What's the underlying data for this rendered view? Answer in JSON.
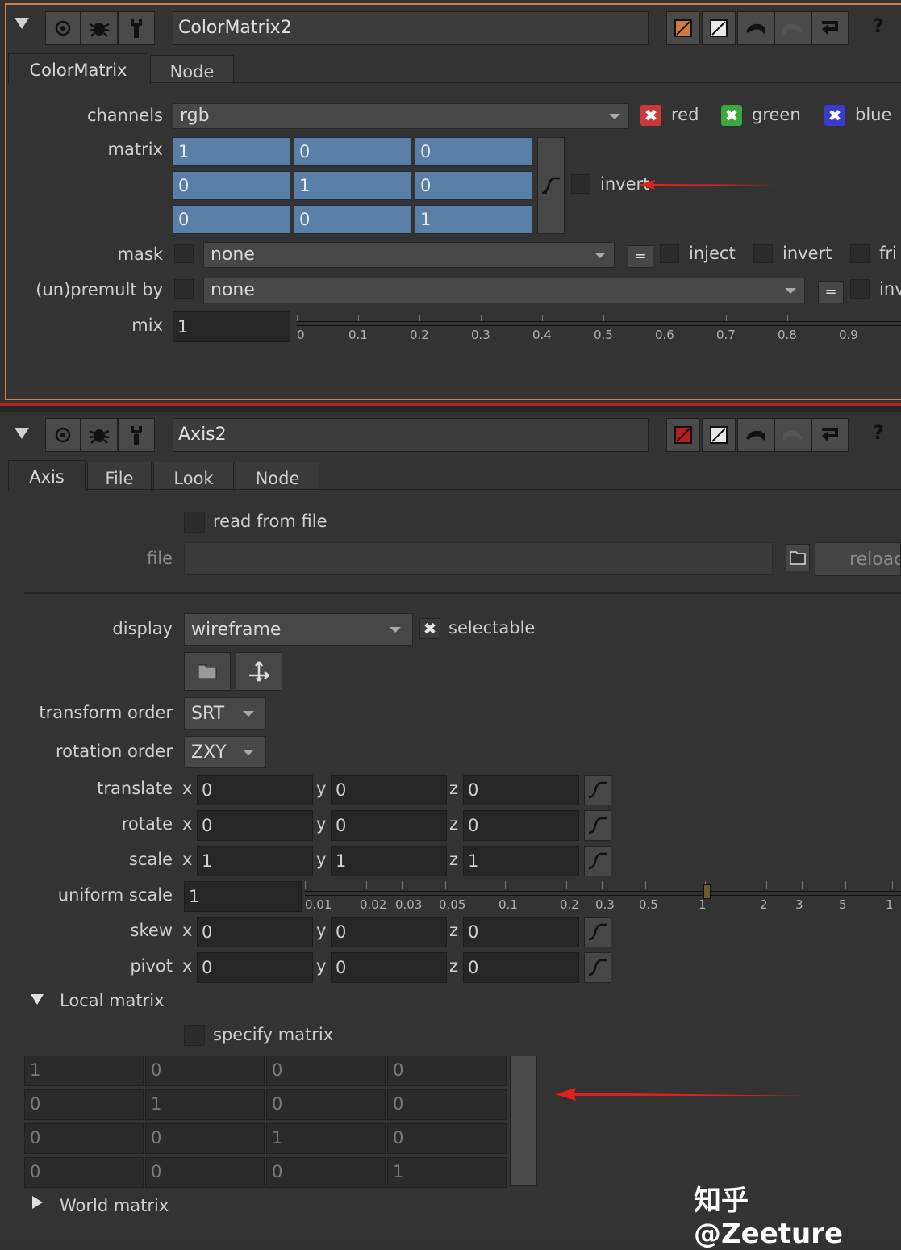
{
  "node1": {
    "name": "ColorMatrix2",
    "tabs": [
      "ColorMatrix",
      "Node"
    ],
    "channels_label": "channels",
    "channels_value": "rgb",
    "channel_checks": [
      {
        "label": "red",
        "color": "#c83a3a"
      },
      {
        "label": "green",
        "color": "#3aa83a"
      },
      {
        "label": "blue",
        "color": "#3a3ad0"
      }
    ],
    "matrix_label": "matrix",
    "matrix": [
      [
        "1",
        "0",
        "0"
      ],
      [
        "0",
        "1",
        "0"
      ],
      [
        "0",
        "0",
        "1"
      ]
    ],
    "invert_label": "invert",
    "mask_label": "mask",
    "mask_value": "none",
    "eq_label": "=",
    "inject_label": "inject",
    "mask_invert_label": "invert",
    "fringe_label": "fri",
    "premult_label": "(un)premult by",
    "premult_value": "none",
    "premult_invert_label": "inv",
    "mix_label": "mix",
    "mix_value": "1",
    "mix_ticks": [
      "0",
      "0.1",
      "0.2",
      "0.3",
      "0.4",
      "0.5",
      "0.6",
      "0.7",
      "0.8",
      "0.9"
    ]
  },
  "node2": {
    "name": "Axis2",
    "tabs": [
      "Axis",
      "File",
      "Look",
      "Node"
    ],
    "read_from_file_label": "read from file",
    "file_label": "file",
    "reload_label": "reload",
    "display_label": "display",
    "display_value": "wireframe",
    "selectable_label": "selectable",
    "transform_order_label": "transform order",
    "transform_order_value": "SRT",
    "rotation_order_label": "rotation order",
    "rotation_order_value": "ZXY",
    "rows": [
      {
        "label": "translate",
        "x": "0",
        "y": "0",
        "z": "0"
      },
      {
        "label": "rotate",
        "x": "0",
        "y": "0",
        "z": "0"
      },
      {
        "label": "scale",
        "x": "1",
        "y": "1",
        "z": "1"
      }
    ],
    "rows2": [
      {
        "label": "skew",
        "x": "0",
        "y": "0",
        "z": "0"
      },
      {
        "label": "pivot",
        "x": "0",
        "y": "0",
        "z": "0"
      }
    ],
    "axis_x": "x",
    "axis_y": "y",
    "axis_z": "z",
    "uniform_scale_label": "uniform scale",
    "uniform_scale_value": "1",
    "uniform_ticks": [
      "0.01",
      "0.02",
      "0.03",
      "0.05",
      "0.1",
      "0.2",
      "0.3",
      "0.5",
      "1",
      "2",
      "3",
      "5",
      "1"
    ],
    "local_matrix_label": "Local matrix",
    "specify_matrix_label": "specify matrix",
    "local_matrix": [
      [
        "1",
        "0",
        "0",
        "0"
      ],
      [
        "0",
        "1",
        "0",
        "0"
      ],
      [
        "0",
        "0",
        "1",
        "0"
      ],
      [
        "0",
        "0",
        "0",
        "1"
      ]
    ],
    "world_matrix_label": "World matrix"
  },
  "watermark": "知乎 @Zeeture",
  "colors": {
    "panel_border": "#c8824a",
    "separator": "#b8221f",
    "arrow": "#e02020",
    "matrix_cell": "#5a7fa6"
  }
}
